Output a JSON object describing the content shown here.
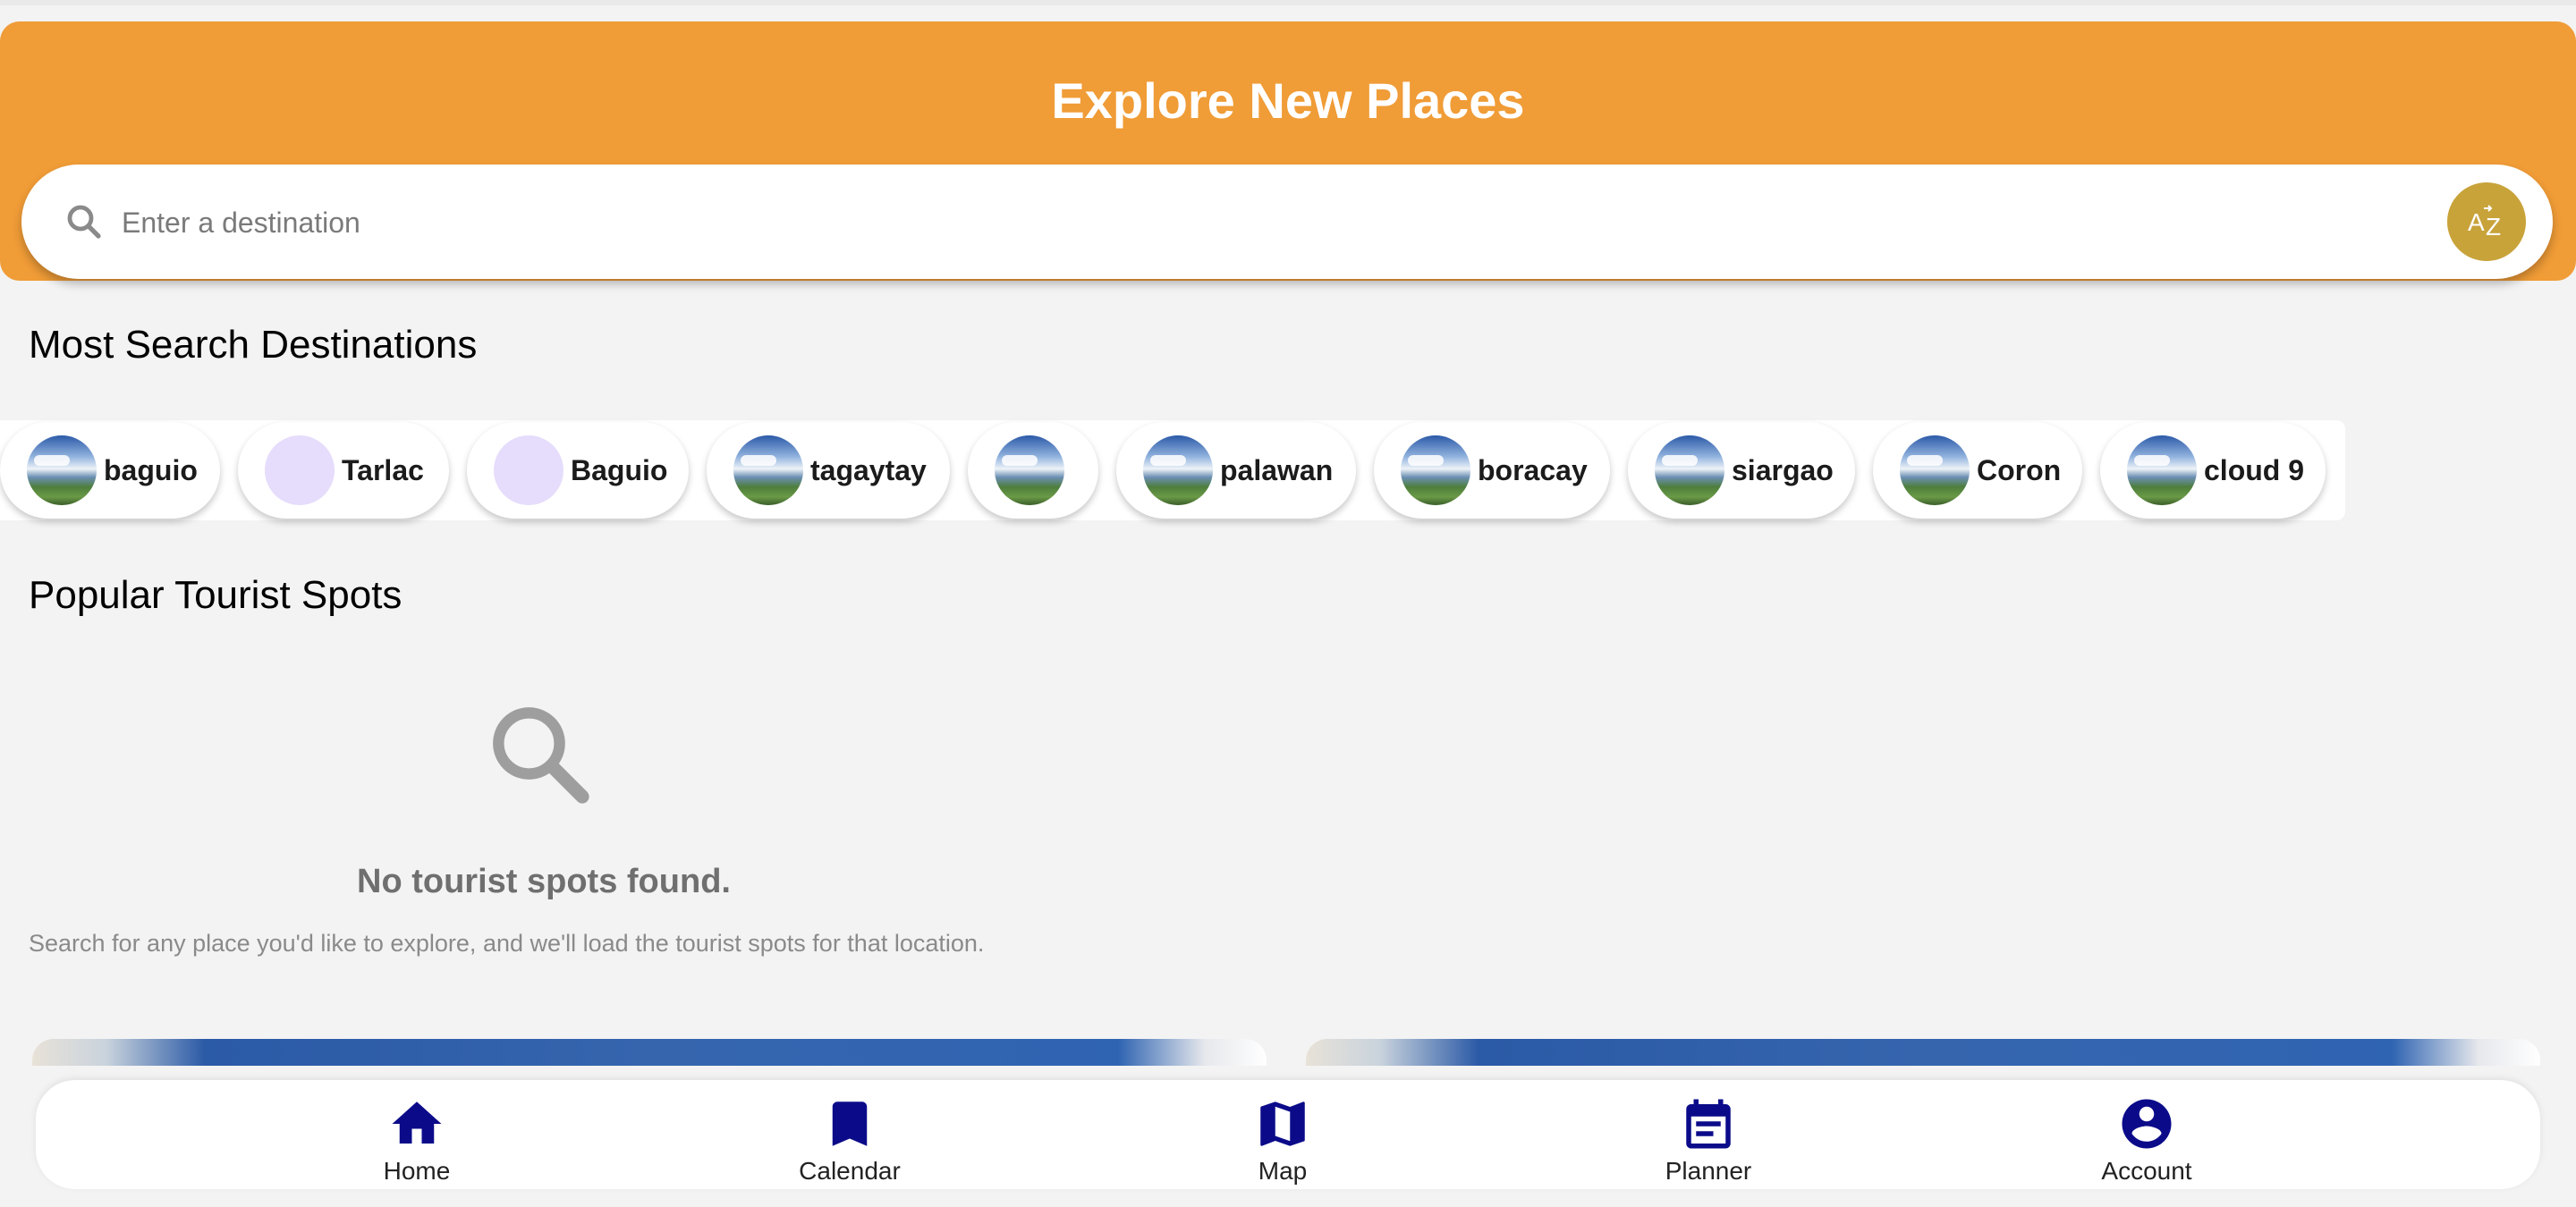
{
  "header": {
    "title": "Explore New Places",
    "accent_color": "#f09c37"
  },
  "search": {
    "placeholder": "Enter a destination",
    "value": "",
    "icon": "search-icon",
    "sort_button_icon": "sort-az-icon",
    "sort_button_color": "#c8a33a"
  },
  "most_searched": {
    "title": "Most Search Destinations",
    "chips": [
      {
        "label": "baguio",
        "avatar": "photo"
      },
      {
        "label": "Tarlac",
        "avatar": "blank"
      },
      {
        "label": "Baguio",
        "avatar": "blank"
      },
      {
        "label": "tagaytay",
        "avatar": "photo"
      },
      {
        "label": "",
        "avatar": "photo"
      },
      {
        "label": "palawan",
        "avatar": "photo"
      },
      {
        "label": "boracay",
        "avatar": "photo"
      },
      {
        "label": "siargao",
        "avatar": "photo"
      },
      {
        "label": "Coron",
        "avatar": "photo"
      },
      {
        "label": "cloud 9",
        "avatar": "photo"
      }
    ]
  },
  "popular": {
    "title": "Popular Tourist Spots",
    "empty_icon": "search-icon",
    "empty_title": "No tourist spots found.",
    "empty_description": "Search for any place you'd like to explore, and we'll load the tourist spots for that location."
  },
  "bottom_nav": {
    "color": "#0b0b8a",
    "items": [
      {
        "label": "Home",
        "icon": "home-icon"
      },
      {
        "label": "Calendar",
        "icon": "bookmark-icon"
      },
      {
        "label": "Map",
        "icon": "map-icon"
      },
      {
        "label": "Planner",
        "icon": "planner-icon"
      },
      {
        "label": "Account",
        "icon": "account-icon"
      }
    ]
  }
}
